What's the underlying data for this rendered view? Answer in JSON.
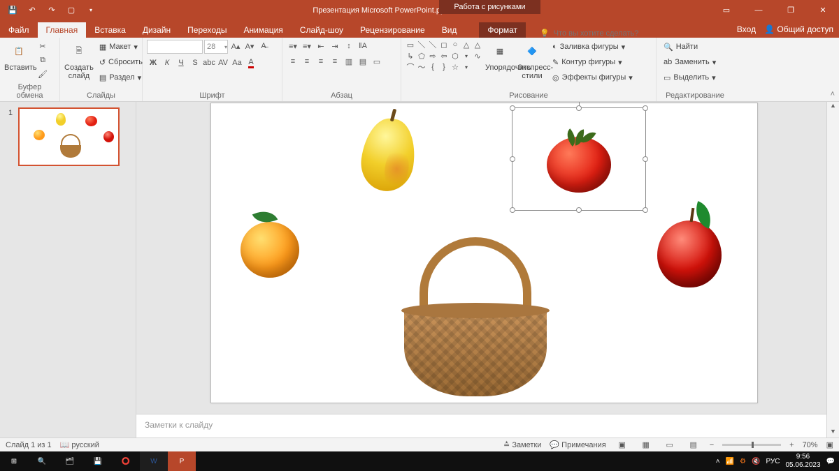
{
  "title": "Презентация Microsoft PowerPoint.pptx - PowerPoint",
  "context_tab_title": "Работа с рисунками",
  "menu": {
    "file": "Файл"
  },
  "tabs": {
    "home": "Главная",
    "insert": "Вставка",
    "design": "Дизайн",
    "transitions": "Переходы",
    "animations": "Анимация",
    "slideshow": "Слайд-шоу",
    "review": "Рецензирование",
    "view": "Вид",
    "format": "Формат"
  },
  "tell_me_placeholder": "Что вы хотите сделать?",
  "signin": "Вход",
  "share": "Общий доступ",
  "ribbon": {
    "clipboard": {
      "label": "Буфер обмена",
      "paste": "Вставить"
    },
    "slides": {
      "label": "Слайды",
      "new_slide": "Создать\nслайд",
      "layout": "Макет",
      "reset": "Сбросить",
      "section": "Раздел"
    },
    "font": {
      "label": "Шрифт",
      "size": "28",
      "bold": "Ж",
      "italic": "К",
      "underline": "Ч",
      "strike": "S",
      "spacing": "abc",
      "clear": "Aa"
    },
    "paragraph": {
      "label": "Абзац"
    },
    "drawing": {
      "label": "Рисование",
      "arrange": "Упорядочить",
      "quick_styles": "Экспресс-\nстили",
      "shape_fill": "Заливка фигуры",
      "shape_outline": "Контур фигуры",
      "shape_effects": "Эффекты фигуры"
    },
    "editing": {
      "label": "Редактирование",
      "find": "Найти",
      "replace": "Заменить",
      "select": "Выделить"
    }
  },
  "thumb_number": "1",
  "notes_placeholder": "Заметки к слайду",
  "status": {
    "slide_counter": "Слайд 1 из 1",
    "language": "русский",
    "notes": "Заметки",
    "comments": "Примечания",
    "zoom": "70%"
  },
  "taskbar": {
    "lang": "РУС",
    "time": "9:56",
    "date": "05.06.2023"
  },
  "slide_objects": {
    "pear": "pear",
    "tomato": "tomato",
    "tomato_selected": true,
    "orange": "orange",
    "apple": "apple",
    "basket": "basket"
  }
}
